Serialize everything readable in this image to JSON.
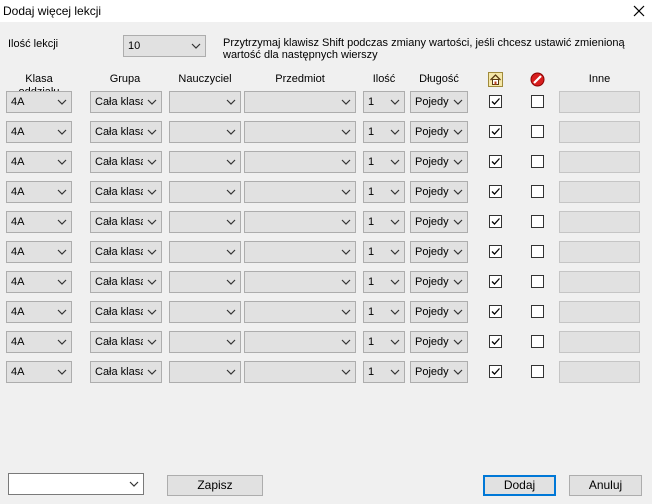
{
  "window": {
    "title": "Dodaj więcej lekcji",
    "close_icon": "close-icon"
  },
  "count": {
    "label": "Ilość lekcji",
    "value": "10"
  },
  "hint": "Przytrzymaj klawisz Shift podczas zmiany wartości, jeśli chcesz ustawić zmienioną wartość dla następnych wierszy",
  "columns": {
    "klasa": "Klasa oddziału",
    "grupa": "Grupa",
    "nauczyciel": "Nauczyciel",
    "przedmiot": "Przedmiot",
    "ilosc": "Ilość",
    "dlugosc": "Długość",
    "home_icon": "home-icon",
    "forbidden_icon": "no-entry-icon",
    "inne": "Inne"
  },
  "rows": [
    {
      "klasa": "4A",
      "grupa": "Cała klasa",
      "nauczyciel": "",
      "przedmiot": "",
      "ilosc": "1",
      "dlugosc": "Pojedyncza",
      "home": true,
      "blocked": false,
      "inne": ""
    },
    {
      "klasa": "4A",
      "grupa": "Cała klasa",
      "nauczyciel": "",
      "przedmiot": "",
      "ilosc": "1",
      "dlugosc": "Pojedyncza",
      "home": true,
      "blocked": false,
      "inne": ""
    },
    {
      "klasa": "4A",
      "grupa": "Cała klasa",
      "nauczyciel": "",
      "przedmiot": "",
      "ilosc": "1",
      "dlugosc": "Pojedyncza",
      "home": true,
      "blocked": false,
      "inne": ""
    },
    {
      "klasa": "4A",
      "grupa": "Cała klasa",
      "nauczyciel": "",
      "przedmiot": "",
      "ilosc": "1",
      "dlugosc": "Pojedyncza",
      "home": true,
      "blocked": false,
      "inne": ""
    },
    {
      "klasa": "4A",
      "grupa": "Cała klasa",
      "nauczyciel": "",
      "przedmiot": "",
      "ilosc": "1",
      "dlugosc": "Pojedyncza",
      "home": true,
      "blocked": false,
      "inne": ""
    },
    {
      "klasa": "4A",
      "grupa": "Cała klasa",
      "nauczyciel": "",
      "przedmiot": "",
      "ilosc": "1",
      "dlugosc": "Pojedyncza",
      "home": true,
      "blocked": false,
      "inne": ""
    },
    {
      "klasa": "4A",
      "grupa": "Cała klasa",
      "nauczyciel": "",
      "przedmiot": "",
      "ilosc": "1",
      "dlugosc": "Pojedyncza",
      "home": true,
      "blocked": false,
      "inne": ""
    },
    {
      "klasa": "4A",
      "grupa": "Cała klasa",
      "nauczyciel": "",
      "przedmiot": "",
      "ilosc": "1",
      "dlugosc": "Pojedyncza",
      "home": true,
      "blocked": false,
      "inne": ""
    },
    {
      "klasa": "4A",
      "grupa": "Cała klasa",
      "nauczyciel": "",
      "przedmiot": "",
      "ilosc": "1",
      "dlugosc": "Pojedyncza",
      "home": true,
      "blocked": false,
      "inne": ""
    },
    {
      "klasa": "4A",
      "grupa": "Cała klasa",
      "nauczyciel": "",
      "przedmiot": "",
      "ilosc": "1",
      "dlugosc": "Pojedyncza",
      "home": true,
      "blocked": false,
      "inne": ""
    }
  ],
  "footer": {
    "preset_value": "",
    "save_label": "Zapisz",
    "add_label": "Dodaj",
    "cancel_label": "Anuluj"
  },
  "colors": {
    "accent": "#0078d7",
    "dialog_bg": "#f0f0f0",
    "button_bg": "#e1e1e1"
  }
}
